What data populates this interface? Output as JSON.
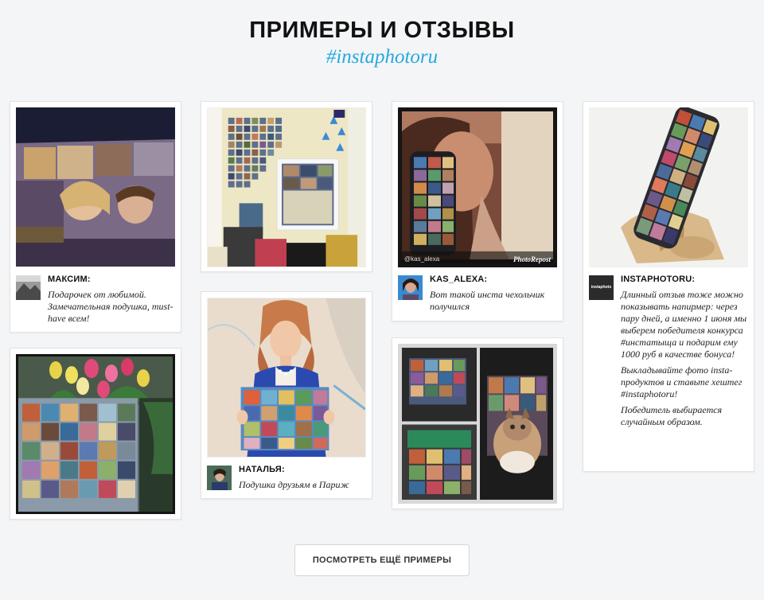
{
  "header": {
    "title": "ПРИМЕРЫ И ОТЗЫВЫ",
    "hashtag": "#instaphotoru"
  },
  "cards": [
    {
      "image": "pillow-couple-photo",
      "user": "МАКСИМ:",
      "text": [
        "Подарочек от любимой. Замечательная подушка, must-have всем!"
      ]
    },
    {
      "image": "photo-wall-room"
    },
    {
      "image": "phone-case-selfie",
      "watermark_left": "@kas_alexa",
      "watermark_right": "PhotoRepost",
      "user": "KAS_ALEXA:",
      "text": [
        "Вот такой инста чехольчик получился"
      ]
    },
    {
      "image": "phone-on-wooden-stand",
      "user": "INSTAPHOTORU:",
      "avatar_label": "instaphoto",
      "text": [
        "Длинный отзыв тоже можно показывать напирмер: через пару дней, а именно 1 июня мы выберем победителя конкурса #инстатыща и подарим ему 1000 руб в качестве бонуса!",
        "Выкладывайте фото insta-продуктов и ставьте хештег #instaphotoru!",
        "Победитель выбирается случайным образом."
      ]
    },
    {
      "image": "tulips-and-pillow"
    },
    {
      "image": "woman-holding-pillow",
      "user": "НАТАЛЬЯ:",
      "text": [
        "Подушка друзьям в Париж"
      ]
    },
    {
      "image": "pillows-collage-with-cat"
    }
  ],
  "more_button": {
    "label": "ПОСМОТРЕТЬ ЕЩЁ ПРИМЕРЫ"
  },
  "colors": {
    "accent": "#27a8df",
    "background": "#f4f5f7"
  }
}
